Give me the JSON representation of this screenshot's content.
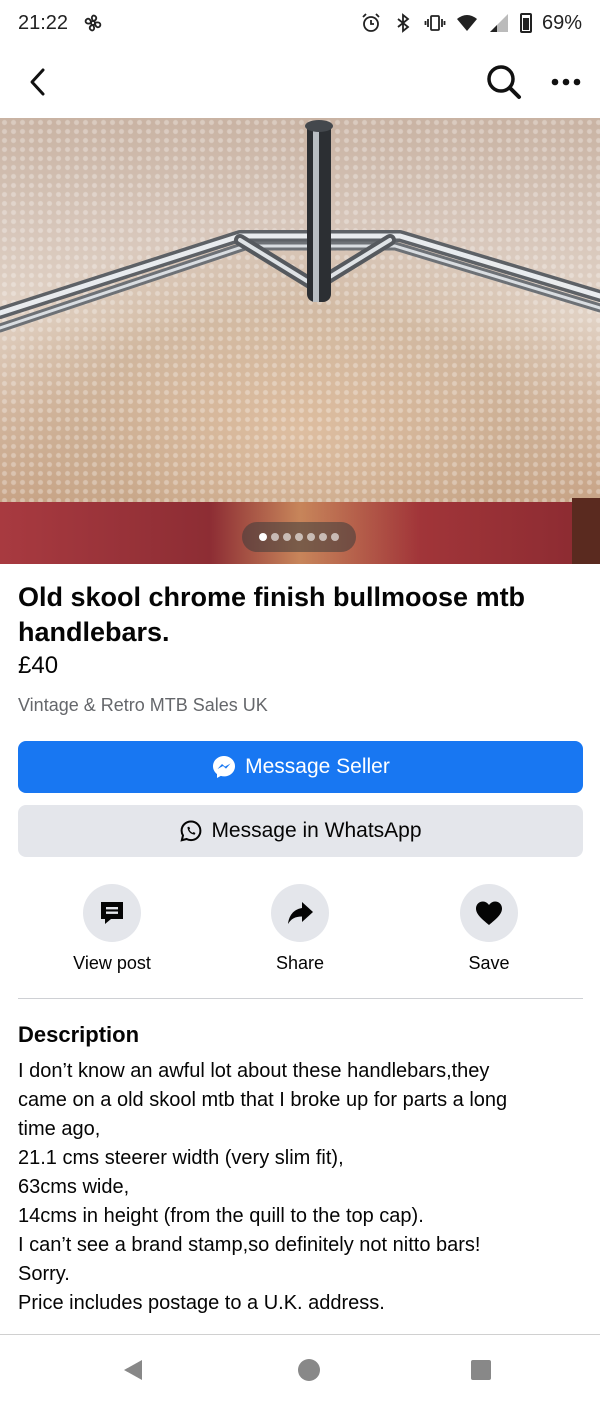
{
  "status_bar": {
    "time": "21:22",
    "battery_percent": "69%",
    "icons": [
      "fan-icon",
      "alarm-icon",
      "bluetooth-icon",
      "vibrate-icon",
      "wifi-icon",
      "signal-icon",
      "battery-icon"
    ]
  },
  "top_nav": {
    "icons": [
      "back-arrow-icon",
      "search-icon",
      "more-options-icon"
    ]
  },
  "photo": {
    "carousel_count": 7,
    "carousel_active_index": 0
  },
  "listing": {
    "title": "Old skool chrome finish bullmoose mtb handlebars.",
    "price": "£40",
    "group": "Vintage & Retro MTB Sales UK"
  },
  "buttons": {
    "message_seller": "Message Seller",
    "message_whatsapp": "Message in WhatsApp"
  },
  "actions": {
    "view_post": "View post",
    "share": "Share",
    "save": "Save"
  },
  "description": {
    "heading": "Description",
    "lines": [
      "I don’t know an awful lot about these handlebars,they",
      "came on a old skool mtb that I broke up for parts a long",
      "time ago,",
      "21.1 cms steerer width (very slim fit),",
      "63cms wide,",
      "14cms in height (from the quill to the top cap).",
      "I can’t see a brand stamp,so definitely not nitto bars!",
      "Sorry.",
      "Price includes postage to a U.K. address."
    ]
  },
  "colors": {
    "primary_blue": "#1877f2",
    "secondary_gray": "#e4e6eb",
    "muted_text": "#65676b"
  }
}
